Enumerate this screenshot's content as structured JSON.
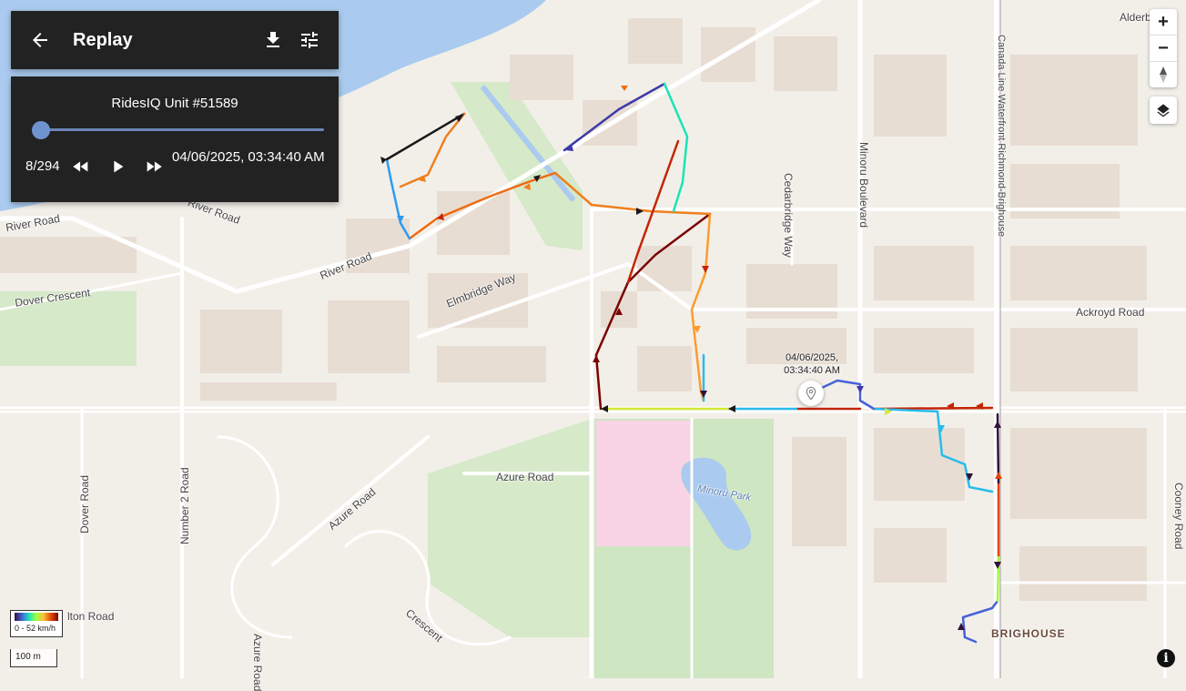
{
  "header": {
    "title": "Replay",
    "back_icon": "arrow-left-icon",
    "download_icon": "download-icon",
    "settings_icon": "tune-icon"
  },
  "player": {
    "unit_name": "RidesIQ Unit #51589",
    "position": "8/294",
    "progress": 0.027,
    "timestamp": "04/06/2025, 03:34:40 AM",
    "rewind_icon": "rewind-icon",
    "play_icon": "play-icon",
    "forward_icon": "fast-forward-icon"
  },
  "map": {
    "marker_label": "04/06/2025,\n03:34:40 AM",
    "speed_legend": "0 - 52 km/h",
    "scale_label": "100 m",
    "zoom_in": "+",
    "zoom_out": "−",
    "north_icon": "compass-icon",
    "layers_icon": "layers-icon",
    "info_icon": "info-icon",
    "street_labels": [
      {
        "id": "river-road-1",
        "text": "River Road"
      },
      {
        "id": "river-road-2",
        "text": "River Road"
      },
      {
        "id": "river-road-3",
        "text": "River Road"
      },
      {
        "id": "dover-crescent",
        "text": "Dover Crescent"
      },
      {
        "id": "elmbridge-way",
        "text": "Elmbridge Way"
      },
      {
        "id": "cedarbridge-way",
        "text": "Cedarbridge Way"
      },
      {
        "id": "minoru-boulevard",
        "text": "Minoru Boulevard"
      },
      {
        "id": "canada-line",
        "text": "Canada Line Waterfront Richmond-Brighouse"
      },
      {
        "id": "ackroyd-road",
        "text": "Ackroyd Road"
      },
      {
        "id": "azure-road-1",
        "text": "Azure Road"
      },
      {
        "id": "azure-road-2",
        "text": "Azure Road"
      },
      {
        "id": "azure-road-3",
        "text": "Azure Road"
      },
      {
        "id": "dover-road",
        "text": "Dover Road"
      },
      {
        "id": "number-2-road",
        "text": "Number 2 Road"
      },
      {
        "id": "minoru-park",
        "text": "Minoru Park"
      },
      {
        "id": "brighouse",
        "text": "BRIGHOUSE"
      },
      {
        "id": "cooney-road",
        "text": "Cooney Road"
      },
      {
        "id": "alderbridge",
        "text": "Alderbri"
      },
      {
        "id": "lton-road",
        "text": "lton Road"
      },
      {
        "id": "crescent",
        "text": "Crescent"
      }
    ]
  },
  "colors": {
    "panel": "#222222",
    "slider": "#6f93cf",
    "water": "#aacbef",
    "park": "#d4e8c8"
  }
}
